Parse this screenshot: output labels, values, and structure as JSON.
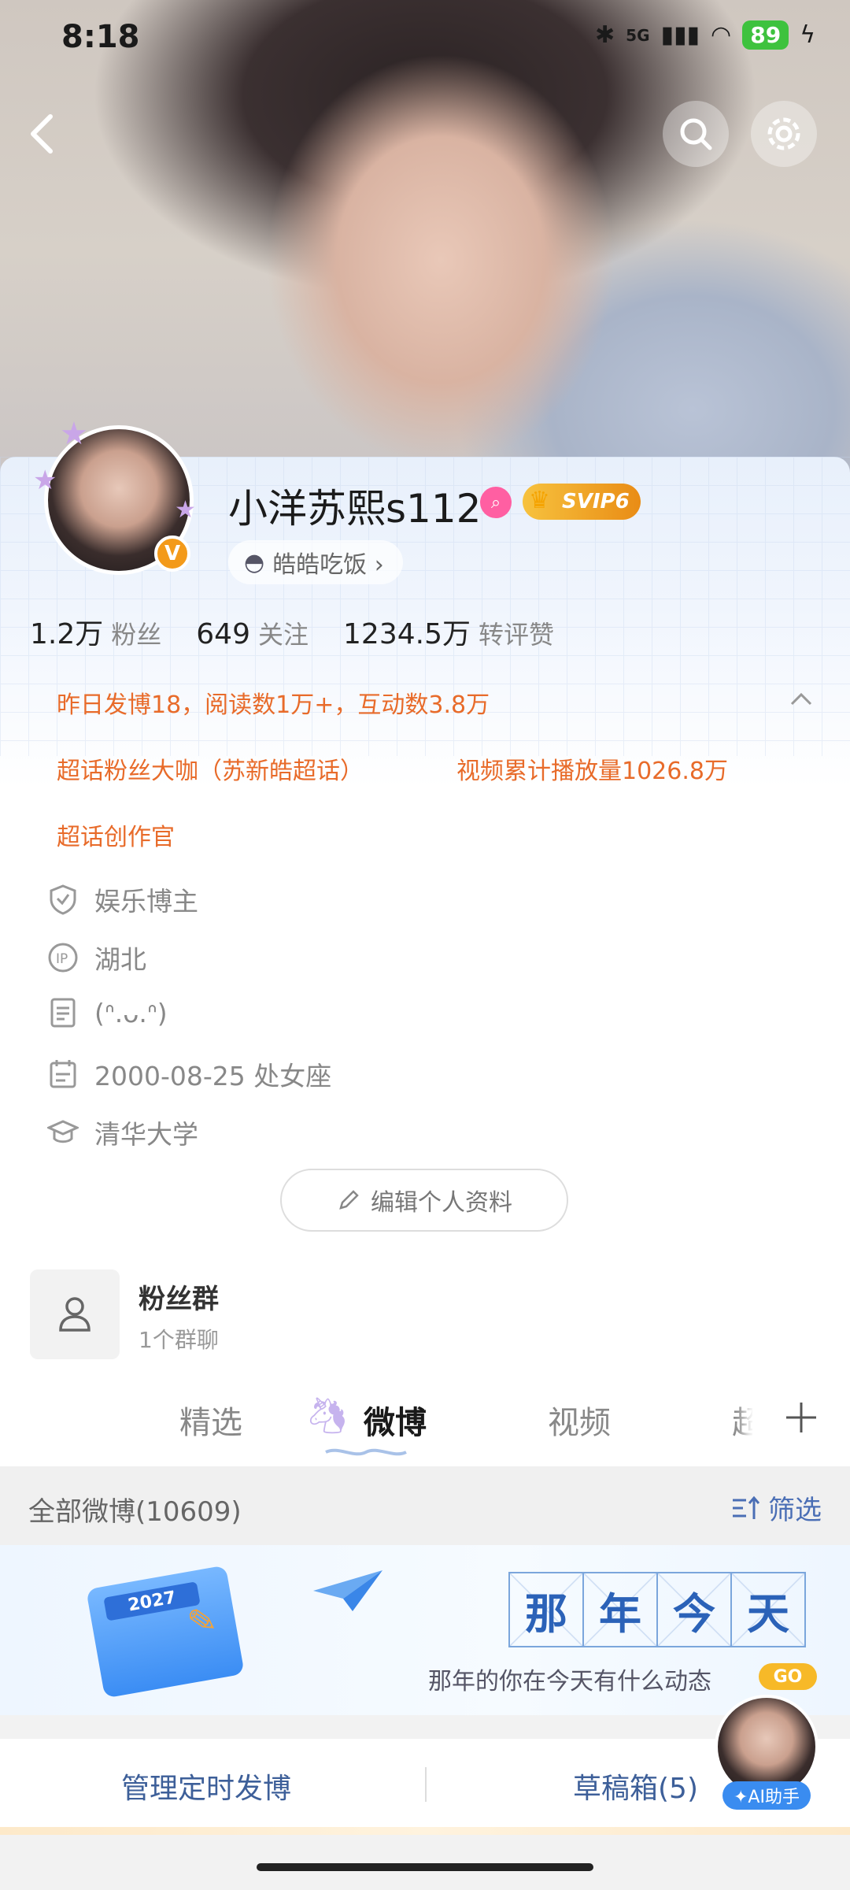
{
  "status_bar": {
    "time": "8:18",
    "network": "5G",
    "battery": "89"
  },
  "header": {
    "back_icon": "chevron-left-icon",
    "search_icon": "search-icon",
    "settings_icon": "gear-icon"
  },
  "profile": {
    "username": "小洋苏熙s112",
    "vip_badge": "SVIP6",
    "verified_badge": "V",
    "group_pill": "皓皓吃饭 ›",
    "stats": [
      {
        "value": "1.2万",
        "label": "粉丝"
      },
      {
        "value": "649",
        "label": "关注"
      },
      {
        "value": "1234.5万",
        "label": "转评赞"
      }
    ],
    "highlights": {
      "daily": "昨日发博18，阅读数1万+，互动数3.8万",
      "superfan": "超话粉丝大咖（苏新皓超话）",
      "video_plays": "视频累计播放量1026.8万",
      "creator": "超话创作官"
    },
    "info": [
      {
        "icon": "shield-icon",
        "text": "娱乐博主"
      },
      {
        "icon": "ip-icon",
        "text": "湖北"
      },
      {
        "icon": "document-icon",
        "text": "(ᐢ.ᴗ.ᐢ)"
      },
      {
        "icon": "calendar-icon",
        "text": "2000-08-25 处女座"
      },
      {
        "icon": "graduation-cap-icon",
        "text": "清华大学"
      }
    ],
    "edit_button": "编辑个人资料"
  },
  "fan_group": {
    "title": "粉丝群",
    "subtitle": "1个群聊"
  },
  "tabs": [
    {
      "label": "精选",
      "active": false
    },
    {
      "label": "微博",
      "active": true
    },
    {
      "label": "视频",
      "active": false
    },
    {
      "label": "超",
      "active": false
    }
  ],
  "filter": {
    "all_posts": "全部微博(10609)",
    "filter_label": "筛选"
  },
  "banner": {
    "calendar_year": "2027",
    "title_chars": [
      "那",
      "年",
      "今",
      "天"
    ],
    "subtitle": "那年的你在今天有什么动态",
    "go_label": "GO"
  },
  "actions": {
    "scheduled": "管理定时发博",
    "drafts": "草稿箱(5)",
    "ai_label": "✦AI助手"
  },
  "colors": {
    "accent_orange": "#e86b2a",
    "link_blue": "#4a6eb5",
    "vip_gold": "#f0a21e"
  }
}
